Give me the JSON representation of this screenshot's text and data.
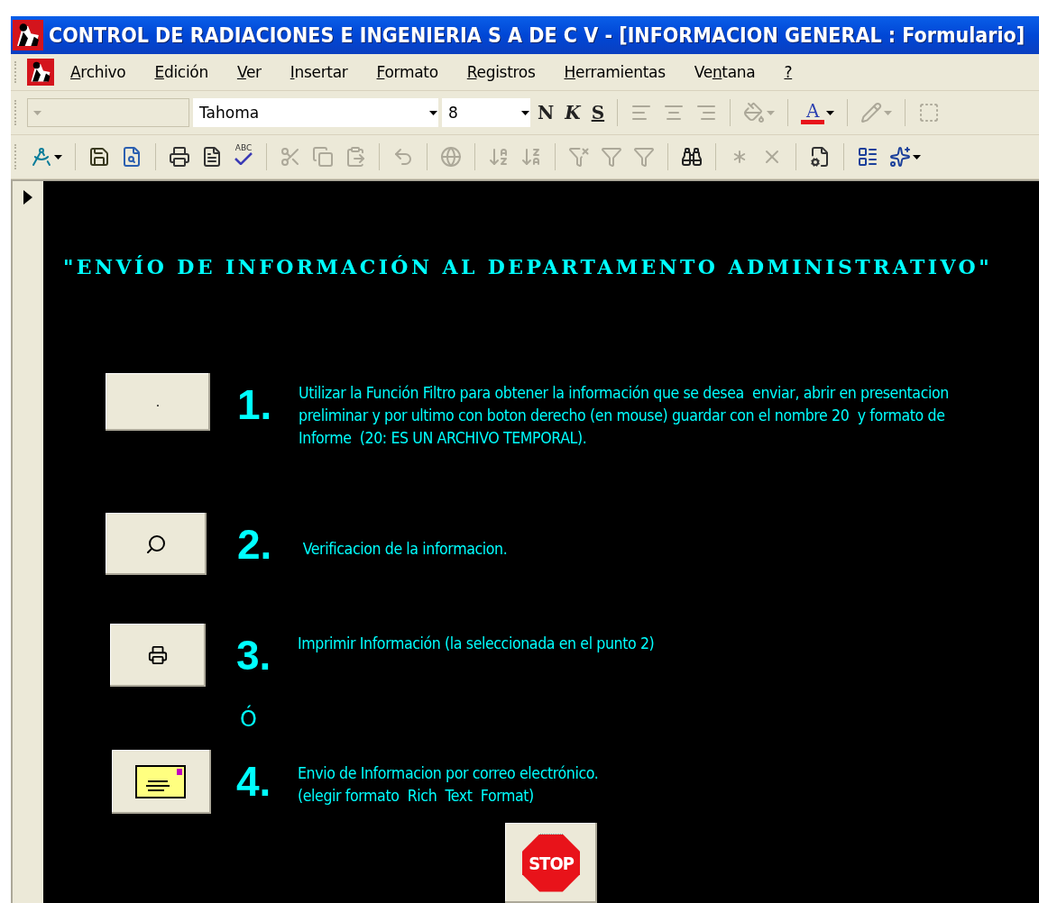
{
  "window": {
    "title": "CONTROL DE RADIACIONES E INGENIERIA S A  DE  C V - [INFORMACION GENERAL : Formulario]"
  },
  "menu": [
    {
      "key": "A",
      "after": "rchivo"
    },
    {
      "key": "E",
      "after": "dición"
    },
    {
      "key": "V",
      "after": "er"
    },
    {
      "key": "I",
      "after": "nsertar"
    },
    {
      "key": "F",
      "after": "ormato"
    },
    {
      "key": "R",
      "after": "egistros"
    },
    {
      "key": "H",
      "after": "erramientas"
    },
    {
      "before": "Ve",
      "key": "n",
      "after": "tana"
    },
    {
      "key": "?"
    }
  ],
  "format_toolbar": [
    {
      "kind": "combo",
      "disabled": true
    },
    {
      "kind": "combo",
      "value": "Tahoma",
      "disabled": false
    },
    {
      "kind": "combo",
      "value": "8",
      "disabled": false
    },
    {
      "kind": "bold",
      "label": "N",
      "disabled": false
    },
    {
      "kind": "italic",
      "label": "K",
      "disabled": false
    },
    {
      "kind": "underline",
      "label": "S",
      "disabled": false
    },
    {
      "kind": "align-left",
      "disabled": true
    },
    {
      "kind": "align-center",
      "disabled": true
    },
    {
      "kind": "align-right",
      "disabled": true
    },
    {
      "kind": "fill",
      "disabled": true,
      "menu": true
    },
    {
      "kind": "fontcolor",
      "label": "A",
      "disabled": false,
      "menu": true
    },
    {
      "kind": "linecolor",
      "disabled": true,
      "menu": true
    },
    {
      "kind": "border",
      "disabled": true
    }
  ],
  "standard_toolbar": [
    {
      "kind": "design",
      "disabled": false,
      "menu": true
    },
    {
      "kind": "save",
      "disabled": false
    },
    {
      "kind": "search",
      "disabled": false
    },
    {
      "kind": "print",
      "disabled": false
    },
    {
      "kind": "preview",
      "disabled": false
    },
    {
      "kind": "spelling",
      "label": "ABC",
      "disabled": false
    },
    {
      "kind": "cut",
      "disabled": true
    },
    {
      "kind": "copy",
      "disabled": true
    },
    {
      "kind": "paste",
      "disabled": true
    },
    {
      "kind": "undo",
      "disabled": true
    },
    {
      "kind": "globe",
      "disabled": true
    },
    {
      "kind": "sortaz",
      "disabled": true
    },
    {
      "kind": "sortza",
      "disabled": true
    },
    {
      "kind": "filtersel",
      "disabled": true
    },
    {
      "kind": "filterform",
      "disabled": true
    },
    {
      "kind": "filter",
      "disabled": true
    },
    {
      "kind": "find",
      "disabled": false
    },
    {
      "kind": "newrecord",
      "disabled": true
    },
    {
      "kind": "deleterecord",
      "disabled": true
    },
    {
      "kind": "properties",
      "disabled": false
    },
    {
      "kind": "database",
      "disabled": false
    },
    {
      "kind": "newobject",
      "disabled": false,
      "menu": true
    }
  ],
  "form": {
    "heading": "\"ENVÍO DE INFORMACIÓN AL DEPARTAMENTO ADMINISTRATIVO\"",
    "steps": [
      {
        "kind": "filter",
        "caption": ".",
        "number": "1.",
        "text": "Utilizar la Función Filtro para obtener la información que se desea  enviar, abrir en presentacion preliminar y por ultimo con boton derecho (en mouse) guardar con el nombre 20  y formato de Informe  (20: ES UN ARCHIVO TEMPORAL)."
      },
      {
        "kind": "verify",
        "number": "2.",
        "text": " Verificacion de la informacion."
      },
      {
        "kind": "print",
        "number": "3.",
        "text": "Imprimir Información (la seleccionada en el punto 2)"
      },
      {
        "kind": "or",
        "text": "Ó"
      },
      {
        "kind": "mail",
        "number": "4.",
        "lines": [
          "Envio de Informacion por correo electrónico.",
          "(elegir formato  Rich  Text  Format)"
        ]
      }
    ],
    "stop_button": {
      "label": "STOP"
    }
  }
}
